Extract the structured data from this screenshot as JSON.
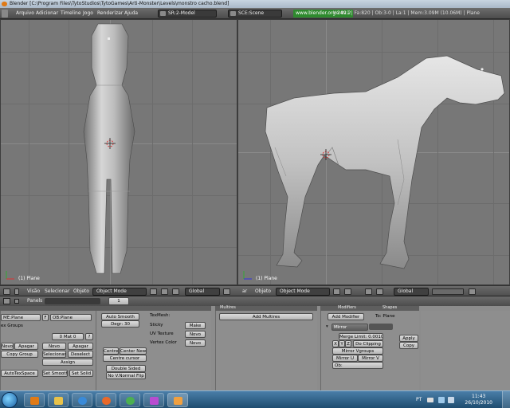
{
  "window": {
    "title": "Blender [C:\\Program Files\\TytoStudios\\TytoGames\\Arti-Monster\\Levels\\monstro cacho.blend]"
  },
  "menubar": {
    "items": [
      "Arquivo",
      "Adicionar",
      "Timeline",
      "Jogo",
      "Renderizar",
      "Ajuda"
    ],
    "screen": "SR:2-Model",
    "scene": "SCE:Scene",
    "url": "www.blender.org 249.2",
    "stats": "Ve:821 | Fa:820 | Ob:3-0 | La:1 | Mem:3.09M (10.06M) | Plane"
  },
  "viewports": {
    "left_label": "(1) Plane",
    "right_label": "(1) Plane"
  },
  "header3d_left": {
    "items": [
      "Visão",
      "Selecionar",
      "Objeto"
    ],
    "mode": "Object Mode",
    "pivot": "Global"
  },
  "header3d_right": {
    "items": [
      "ar",
      "Objeto"
    ],
    "mode": "Object Mode",
    "pivot": "Global"
  },
  "buttons_window": {
    "panels_label": "Panels",
    "frame": "1",
    "link": {
      "me_field": "ME:Plane",
      "f_label": "F",
      "ob_field": "OB:Plane",
      "vertex_groups": "ex Groups",
      "mat_field": "0 Mat 0",
      "mat_q": "?",
      "novo": "Novo",
      "apagar": "Apagar",
      "novo2": "Novo",
      "apagar2": "Apagar",
      "copy_group": "Copy Group",
      "selecionar": "Selecionar",
      "deselect": "Deselect",
      "assign": "Assign",
      "autotexspace": "AutoTexSpace",
      "set_smooth": "Set Smooth",
      "set_solid": "Set Solid"
    },
    "mesh": {
      "auto_smooth": "Auto Smooth",
      "degr": "Degr: 30",
      "centre": "Centre",
      "center_new": "Center New",
      "centre_cursor": "Centre cursor",
      "double_sided": "Double Sided",
      "no_v_normal_flip": "No V.Normal Flip"
    },
    "texmesh": {
      "texmesh": "TexMesh:",
      "sticky": "Sticky",
      "make": "Make",
      "uv_texture": "UV Texture",
      "novo": "Novo",
      "vertex_color": "Vertex Color",
      "novo2": "Novo"
    },
    "multires": {
      "tab": "Multires",
      "add_multires": "Add Multires"
    },
    "modifiers": {
      "tab": "Modifiers",
      "tab2": "Shapes",
      "add_modifier": "Add Modifier",
      "to": "To: Plane",
      "mirror": "Mirror",
      "merge_limit": "Merge Limit: 0.0010",
      "x": "X",
      "y": "Y",
      "z": "Z",
      "do_clipping": "Do Clipping",
      "mirror_vgroups": "Mirror Vgroups",
      "mirror_u": "Mirror U",
      "mirror_v": "Mirror V",
      "ob": "Ob:",
      "apply": "Apply",
      "copy": "Copy"
    }
  },
  "taskbar": {
    "lang": "PT",
    "time": "11:43",
    "date": "26/10/2010"
  },
  "colors": {
    "viewport_bg": "#777777",
    "buttons_bg": "#8c8c8c",
    "url_green": "#2e8a2e",
    "mesh_gray": "#c9c9c9"
  }
}
